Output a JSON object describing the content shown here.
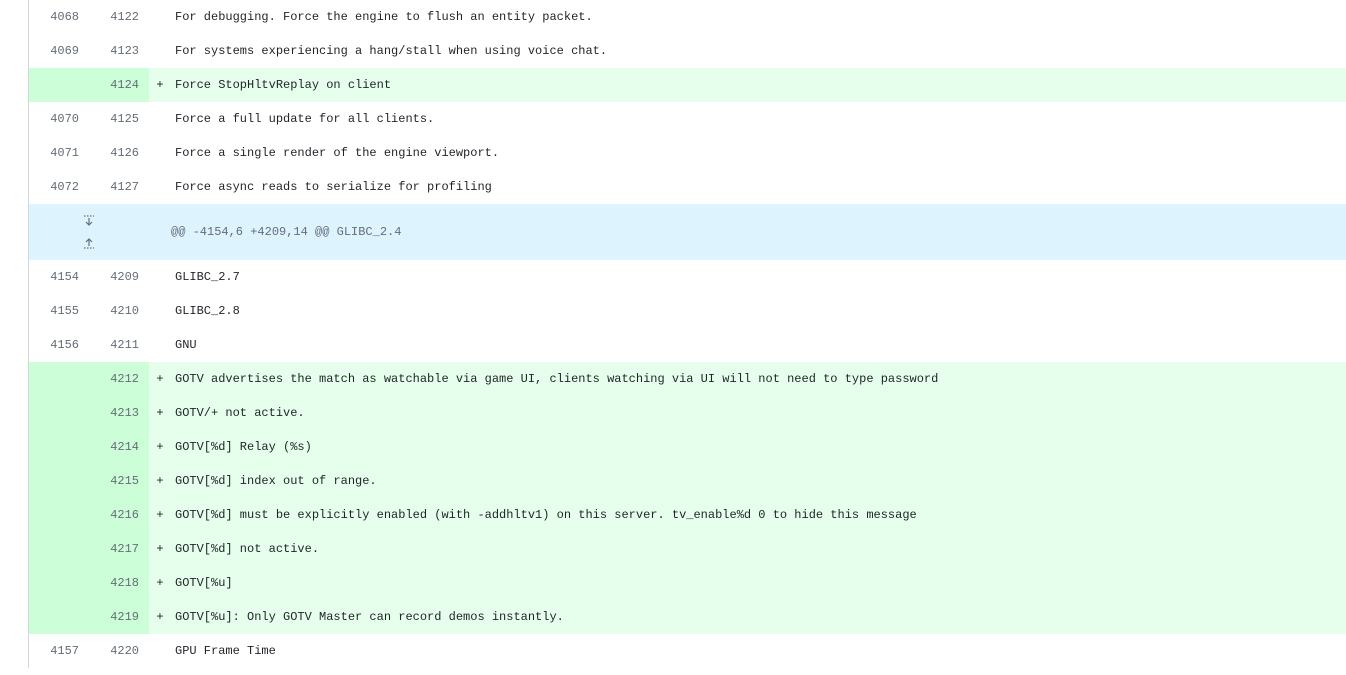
{
  "diff": {
    "rows": [
      {
        "type": "context",
        "old": "4068",
        "new": "4122",
        "marker": "",
        "code": "For debugging. Force the engine to flush an entity packet."
      },
      {
        "type": "context",
        "old": "4069",
        "new": "4123",
        "marker": "",
        "code": "For systems experiencing a hang/stall when using voice chat."
      },
      {
        "type": "addition",
        "old": "",
        "new": "4124",
        "marker": "+",
        "code": "Force StopHltvReplay on client"
      },
      {
        "type": "context",
        "old": "4070",
        "new": "4125",
        "marker": "",
        "code": "Force a full update for all clients."
      },
      {
        "type": "context",
        "old": "4071",
        "new": "4126",
        "marker": "",
        "code": "Force a single render of the engine viewport."
      },
      {
        "type": "context",
        "old": "4072",
        "new": "4127",
        "marker": "",
        "code": "Force async reads to serialize for profiling"
      },
      {
        "type": "hunk",
        "header": "@@ -4154,6 +4209,14 @@ GLIBC_2.4"
      },
      {
        "type": "context",
        "old": "4154",
        "new": "4209",
        "marker": "",
        "code": "GLIBC_2.7"
      },
      {
        "type": "context",
        "old": "4155",
        "new": "4210",
        "marker": "",
        "code": "GLIBC_2.8"
      },
      {
        "type": "context",
        "old": "4156",
        "new": "4211",
        "marker": "",
        "code": "GNU"
      },
      {
        "type": "addition",
        "old": "",
        "new": "4212",
        "marker": "+",
        "code": "GOTV advertises the match as watchable via game UI, clients watching via UI will not need to type password"
      },
      {
        "type": "addition",
        "old": "",
        "new": "4213",
        "marker": "+",
        "code": "GOTV/+ not active."
      },
      {
        "type": "addition",
        "old": "",
        "new": "4214",
        "marker": "+",
        "code": "GOTV[%d] Relay (%s)"
      },
      {
        "type": "addition",
        "old": "",
        "new": "4215",
        "marker": "+",
        "code": "GOTV[%d] index out of range."
      },
      {
        "type": "addition",
        "old": "",
        "new": "4216",
        "marker": "+",
        "code": "GOTV[%d] must be explicitly enabled (with -addhltv1) on this server. tv_enable%d 0 to hide this message"
      },
      {
        "type": "addition",
        "old": "",
        "new": "4217",
        "marker": "+",
        "code": "GOTV[%d] not active."
      },
      {
        "type": "addition",
        "old": "",
        "new": "4218",
        "marker": "+",
        "code": "GOTV[%u]"
      },
      {
        "type": "addition",
        "old": "",
        "new": "4219",
        "marker": "+",
        "code": "GOTV[%u]: Only GOTV Master can record demos instantly."
      },
      {
        "type": "context",
        "old": "4157",
        "new": "4220",
        "marker": "",
        "code": "GPU Frame Time"
      }
    ]
  },
  "icons": {
    "expand_down": "expand-down-icon",
    "expand_up": "expand-up-icon"
  }
}
